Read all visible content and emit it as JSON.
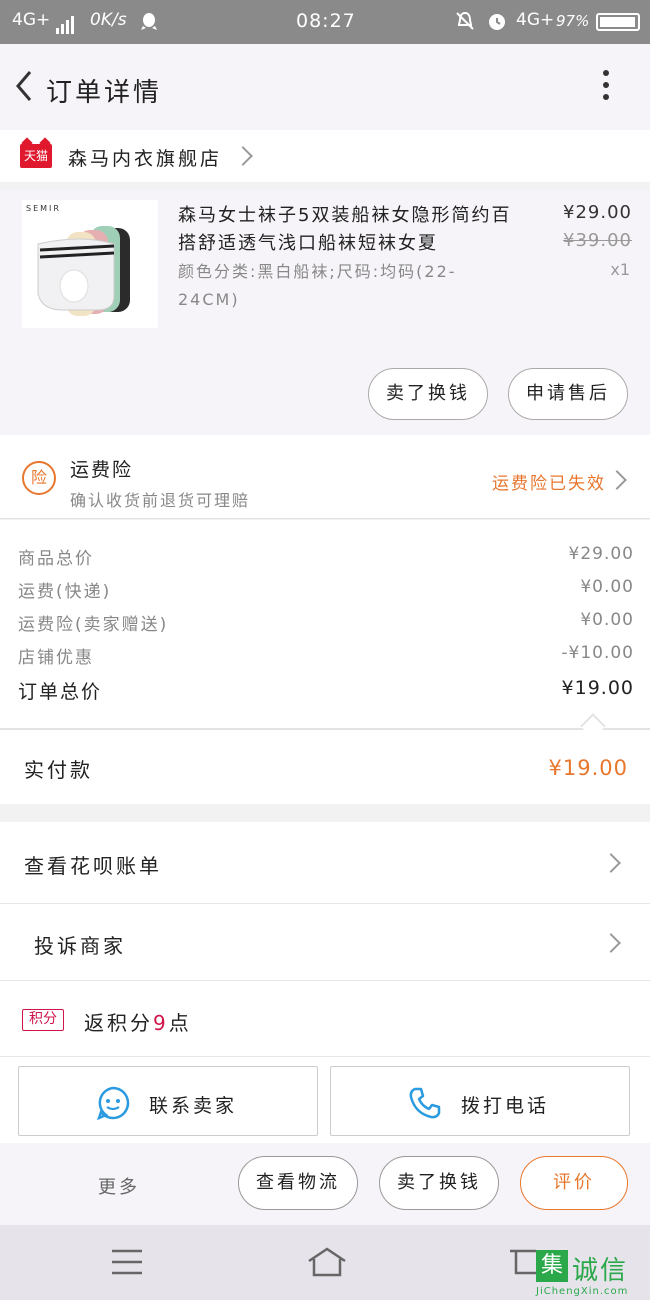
{
  "status_bar": {
    "network_left": "4G+",
    "speed": "0K/s",
    "time": "08:27",
    "network_right": "4G+",
    "battery": "97%"
  },
  "header": {
    "title": "订单详情"
  },
  "shop": {
    "badge": "天猫",
    "name": "森马内衣旗舰店"
  },
  "product": {
    "image_brand": "SEMIR",
    "name": "森马女士袜子5双装船袜女隐形简约百搭舒适透气浅口船袜短袜女夏",
    "sku": "颜色分类:黑白船袜;尺码:均码(22-24CM)",
    "price": "¥29.00",
    "original_price": "¥39.00",
    "quantity": "x1",
    "buttons": {
      "exchange": "卖了换钱",
      "after_sale": "申请售后"
    }
  },
  "insurance": {
    "icon_char": "险",
    "title": "运费险",
    "subtitle": "确认收货前退货可理赔",
    "status": "运费险已失效"
  },
  "totals": [
    {
      "label": "商品总价",
      "value": "¥29.00"
    },
    {
      "label": "运费(快递)",
      "value": "¥0.00"
    },
    {
      "label": "运费险(卖家赠送)",
      "value": "¥0.00"
    },
    {
      "label": "店铺优惠",
      "value": "-¥10.00"
    },
    {
      "label": "订单总价",
      "value": "¥19.00"
    }
  ],
  "paid": {
    "label": "实付款",
    "value": "¥19.00"
  },
  "links": {
    "huabei": "查看花呗账单",
    "complain": "投诉商家"
  },
  "points": {
    "badge": "积分",
    "prefix": "返积分",
    "count": "9",
    "suffix": "点"
  },
  "contact": {
    "seller": "联系卖家",
    "call": "拨打电话"
  },
  "actions": {
    "more": "更多",
    "logistics": "查看物流",
    "exchange": "卖了换钱",
    "review": "评价"
  },
  "watermark": {
    "box": "集",
    "text": "诚信",
    "url": "JiChengXin.com"
  },
  "colors": {
    "accent": "#e8772e",
    "tmall_red": "#e0182d",
    "points_red": "#d0154a",
    "contact_blue": "#2a9be0"
  }
}
